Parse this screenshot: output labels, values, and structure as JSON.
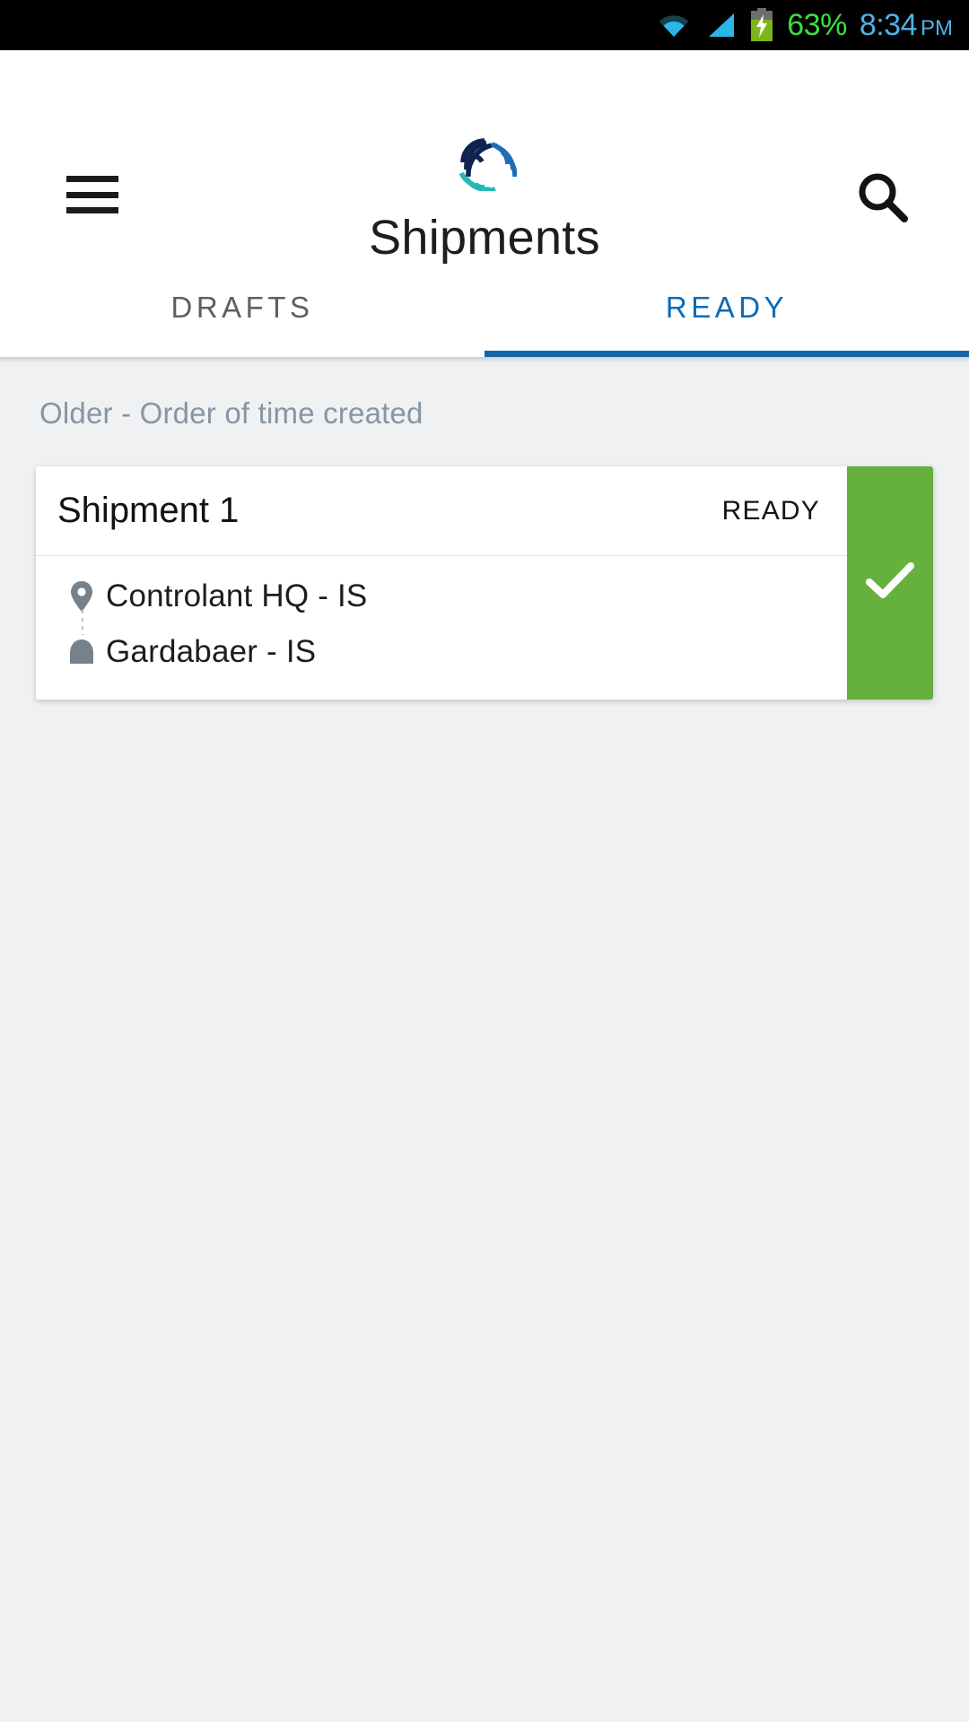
{
  "status_bar": {
    "wifi_icon": "wifi-icon",
    "signal_icon": "signal-icon",
    "battery_icon": "battery-charging-icon",
    "battery_percent": "63%",
    "time": "8:34",
    "am_pm": "PM",
    "battery_color": "#3ce03c",
    "time_color": "#4db3e8",
    "background": "#000000"
  },
  "app_bar": {
    "menu_icon": "hamburger-menu-icon",
    "logo_icon": "controlant-logo-icon",
    "title": "Shipments",
    "search_icon": "search-icon",
    "background": "#ffffff"
  },
  "tabs": [
    {
      "label": "DRAFTS",
      "active": false
    },
    {
      "label": "READY",
      "active": true
    }
  ],
  "tab_active_color": "#0d6bb5",
  "tab_inactive_color": "#5f5f5f",
  "content": {
    "section_label": "Older - Order of time created",
    "background": "#eff1f2"
  },
  "shipments": [
    {
      "title": "Shipment 1",
      "status": "READY",
      "status_stripe_color": "#66b13e",
      "check_icon": "check-icon",
      "origin": {
        "icon": "map-pin-icon",
        "label": "Controlant HQ - IS"
      },
      "destination": {
        "icon": "home-icon",
        "label": "Gardabaer - IS"
      }
    }
  ]
}
